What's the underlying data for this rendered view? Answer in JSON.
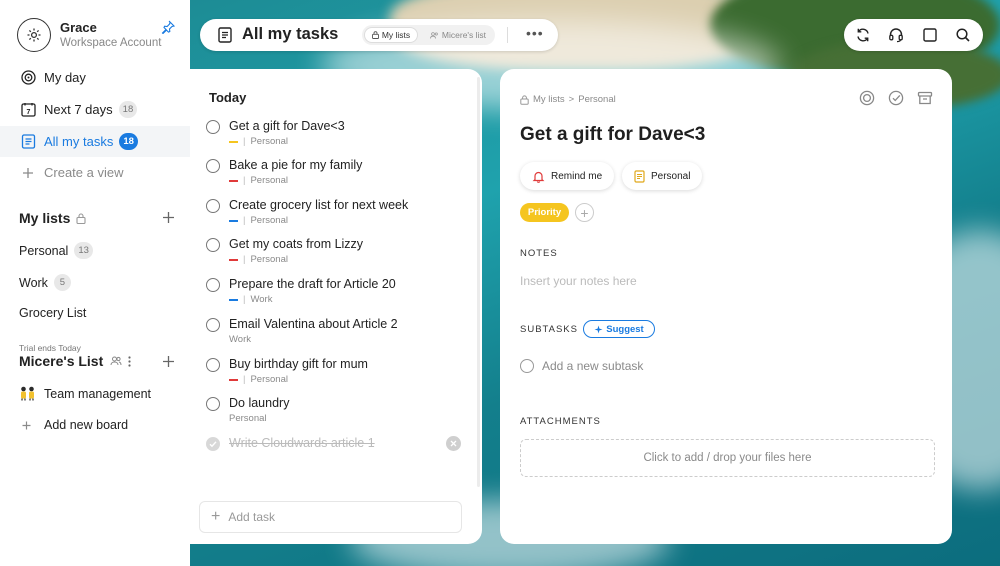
{
  "account": {
    "name": "Grace",
    "subtitle": "Workspace Account"
  },
  "nav": [
    {
      "label": "My day",
      "icon": "target-icon"
    },
    {
      "label": "Next 7 days",
      "icon": "calendar-7-icon",
      "count": "18"
    },
    {
      "label": "All my tasks",
      "icon": "list-icon",
      "count": "18",
      "active": true
    },
    {
      "label": "Create a view",
      "icon": "plus-icon"
    }
  ],
  "my_lists": {
    "title": "My lists",
    "items": [
      {
        "label": "Personal",
        "count": "13"
      },
      {
        "label": "Work",
        "count": "5"
      },
      {
        "label": "Grocery List"
      }
    ]
  },
  "shared": {
    "trial": "Trial ends Today",
    "title": "Micere's List",
    "items": [
      {
        "label": "Team management",
        "icon": "people-emoji-icon"
      },
      {
        "label": "Add new board",
        "icon": "plus-icon"
      }
    ]
  },
  "topbar": {
    "title": "All my tasks",
    "tab_a": "My lists",
    "tab_b": "Micere's list",
    "more": "•••"
  },
  "task_list": {
    "heading": "Today",
    "tasks": [
      {
        "title": "Get a gift for Dave<3",
        "list": "Personal",
        "color": "#f5c51f"
      },
      {
        "title": "Bake a pie for my family",
        "list": "Personal",
        "color": "#e03a3a"
      },
      {
        "title": "Create grocery list for next week",
        "list": "Personal",
        "color": "#1a7be0"
      },
      {
        "title": "Get my coats from Lizzy",
        "list": "Personal",
        "color": "#e03a3a"
      },
      {
        "title": "Prepare the draft for Article 20",
        "list": "Work",
        "color": "#1a7be0"
      },
      {
        "title": "Email Valentina about Article 2",
        "list": "Work"
      },
      {
        "title": "Buy birthday gift for mum",
        "list": "Personal",
        "color": "#e03a3a"
      },
      {
        "title": "Do laundry",
        "list": "Personal"
      },
      {
        "title": "Write Cloudwards article 1",
        "done": true
      }
    ],
    "add_placeholder": "Add task"
  },
  "detail": {
    "breadcrumb_root": "My lists",
    "breadcrumb_sep": ">",
    "breadcrumb_leaf": "Personal",
    "title": "Get a gift for Dave<3",
    "remind": "Remind me",
    "list_pill": "Personal",
    "priority": "Priority",
    "notes_label": "NOTES",
    "notes_placeholder": "Insert your notes here",
    "subtasks_label": "SUBTASKS",
    "suggest": "Suggest",
    "add_subtask": "Add a new subtask",
    "attachments_label": "ATTACHMENTS",
    "drop_text": "Click to add / drop your files here"
  },
  "colors": {
    "accent": "#1a7be0",
    "priority": "#f5c51f",
    "red": "#e03a3a"
  }
}
